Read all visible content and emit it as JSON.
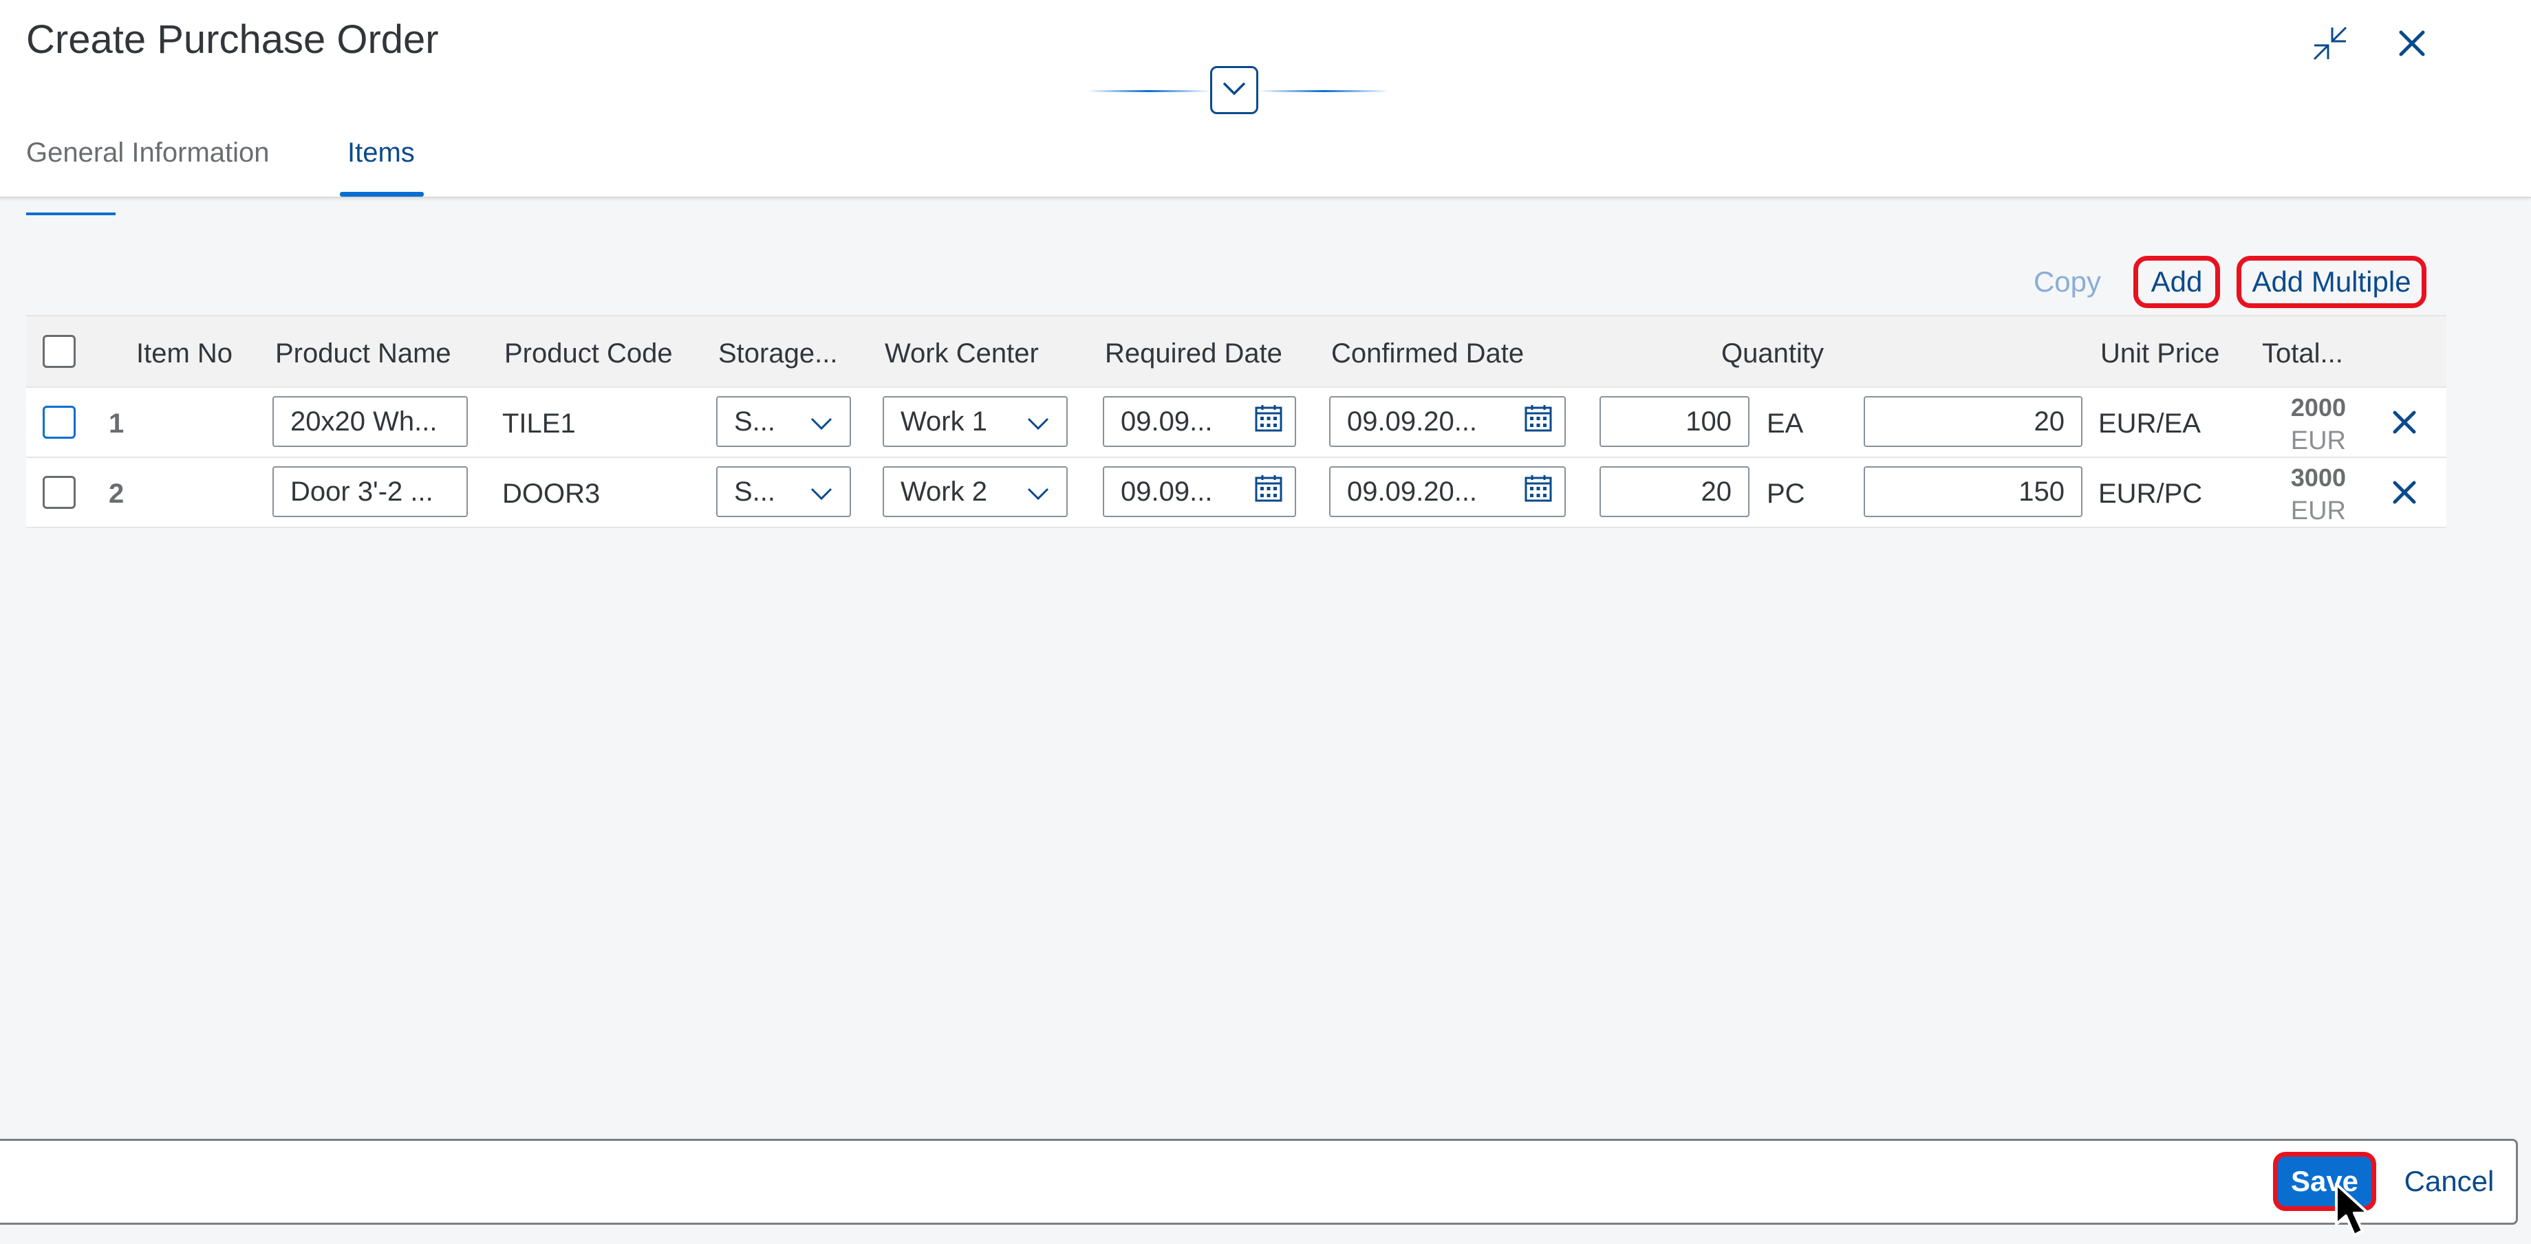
{
  "dialog": {
    "title": "Create Purchase Order",
    "exit_fullscreen_icon": "exit-fullscreen-icon",
    "close_icon": "close-icon"
  },
  "tabs": [
    {
      "label": "General Information",
      "selected": false
    },
    {
      "label": "Items",
      "selected": true
    }
  ],
  "toolbar": {
    "copy_label": "Copy",
    "add_label": "Add",
    "add_multiple_label": "Add Multiple"
  },
  "table": {
    "headers": {
      "item_no": "Item No",
      "product_name": "Product Name",
      "product_code": "Product Code",
      "storage": "Storage...",
      "work_center": "Work Center",
      "required_date": "Required Date",
      "confirmed_date": "Confirmed Date",
      "quantity": "Quantity",
      "unit_price": "Unit Price",
      "total": "Total..."
    },
    "rows": [
      {
        "item_no": "1",
        "product_name": "20x20 Wh...",
        "product_code": "TILE1",
        "storage": "S...",
        "work_center": "Work 1",
        "required_date": "09.09...",
        "confirmed_date": "09.09.20...",
        "quantity": "100",
        "uom": "EA",
        "price": "20",
        "unit_price": "EUR/EA",
        "total": "2000",
        "currency": "EUR"
      },
      {
        "item_no": "2",
        "product_name": "Door 3'-2 ...",
        "product_code": "DOOR3",
        "storage": "S...",
        "work_center": "Work 2",
        "required_date": "09.09...",
        "confirmed_date": "09.09.20...",
        "quantity": "20",
        "uom": "PC",
        "price": "150",
        "unit_price": "EUR/PC",
        "total": "3000",
        "currency": "EUR"
      }
    ]
  },
  "footer": {
    "save_label": "Save",
    "cancel_label": "Cancel"
  },
  "colors": {
    "accent": "#0a6ed1",
    "link": "#0a4a8c",
    "highlight": "#e8121f"
  }
}
